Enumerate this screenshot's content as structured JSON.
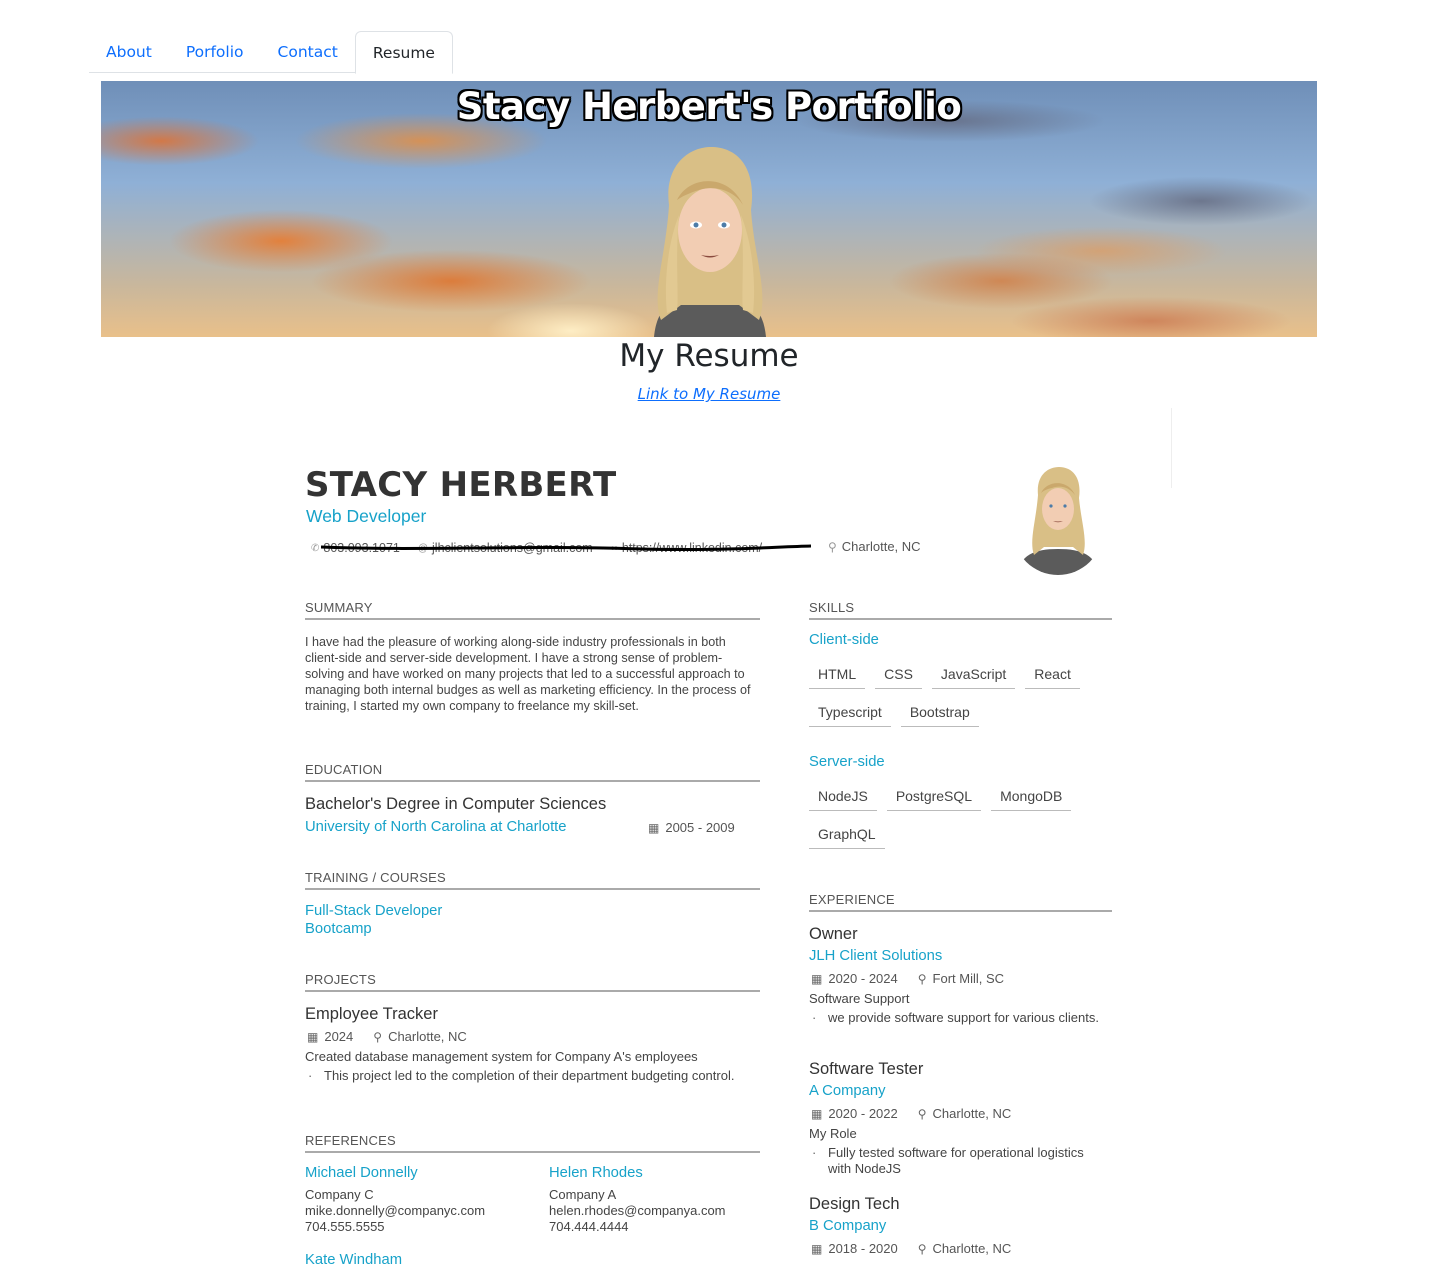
{
  "tabs": [
    {
      "label": "About"
    },
    {
      "label": "Porfolio"
    },
    {
      "label": "Contact"
    },
    {
      "label": "Resume"
    }
  ],
  "banner": {
    "title": "Stacy Herbert's Portfolio"
  },
  "resume_page": {
    "heading": "My Resume",
    "link_label": "Link to My Resume"
  },
  "resume": {
    "name": "STACY HERBERT",
    "role": "Web Developer",
    "contacts": {
      "phone": "803.093.1071",
      "email": "jlhclientsolutions@gmail.com",
      "website": "https://www.linkedin.com/",
      "location": "Charlotte, NC"
    },
    "summary": {
      "title": "SUMMARY",
      "text": "I have had the pleasure of working along-side industry professionals in both client-side and server-side development. I have a strong sense of problem-solving and have worked on many projects that led to a successful approach to managing both internal budges as well as marketing efficiency. In the process of training, I started my own company to freelance my skill-set."
    },
    "education": {
      "title": "EDUCATION",
      "degree": "Bachelor's Degree in Computer Sciences",
      "school": "University of North Carolina at Charlotte",
      "dates": "2005 - 2009"
    },
    "training": {
      "title": "TRAINING / COURSES",
      "line1": "Full-Stack Developer",
      "line2": "Bootcamp"
    },
    "projects": {
      "title": "PROJECTS",
      "items": [
        {
          "name": "Employee Tracker",
          "year": "2024",
          "location": "Charlotte, NC",
          "description": "Created database management system for Company A's employees",
          "bullet": "This project led to the completion of their department budgeting control."
        }
      ]
    },
    "references": {
      "title": "REFERENCES",
      "items": [
        {
          "name": "Michael Donnelly",
          "company": "Company C",
          "email": "mike.donnelly@companyc.com",
          "phone": "704.555.5555"
        },
        {
          "name": "Helen Rhodes",
          "company": "Company A",
          "email": "helen.rhodes@companya.com",
          "phone": "704.444.4444"
        },
        {
          "name": "Kate Windham"
        }
      ]
    },
    "skills": {
      "title": "SKILLS",
      "groups": [
        {
          "name": "Client-side",
          "tags": [
            "HTML",
            "CSS",
            "JavaScript",
            "React",
            "Typescript",
            "Bootstrap"
          ]
        },
        {
          "name": "Server-side",
          "tags": [
            "NodeJS",
            "PostgreSQL",
            "MongoDB",
            "GraphQL"
          ]
        }
      ]
    },
    "experience": {
      "title": "EXPERIENCE",
      "items": [
        {
          "position": "Owner",
          "company": "JLH Client Solutions",
          "dates": "2020 - 2024",
          "location": "Fort Mill, SC",
          "summary": "Software Support",
          "bullet": "we provide software support for various clients."
        },
        {
          "position": "Software Tester",
          "company": "A Company",
          "dates": "2020 - 2022",
          "location": "Charlotte, NC",
          "summary": "My Role",
          "bullet": "Fully tested software for operational logistics with NodeJS"
        },
        {
          "position": "Design Tech",
          "company": "B Company",
          "dates": "2018 - 2020",
          "location": "Charlotte, NC"
        }
      ]
    }
  }
}
